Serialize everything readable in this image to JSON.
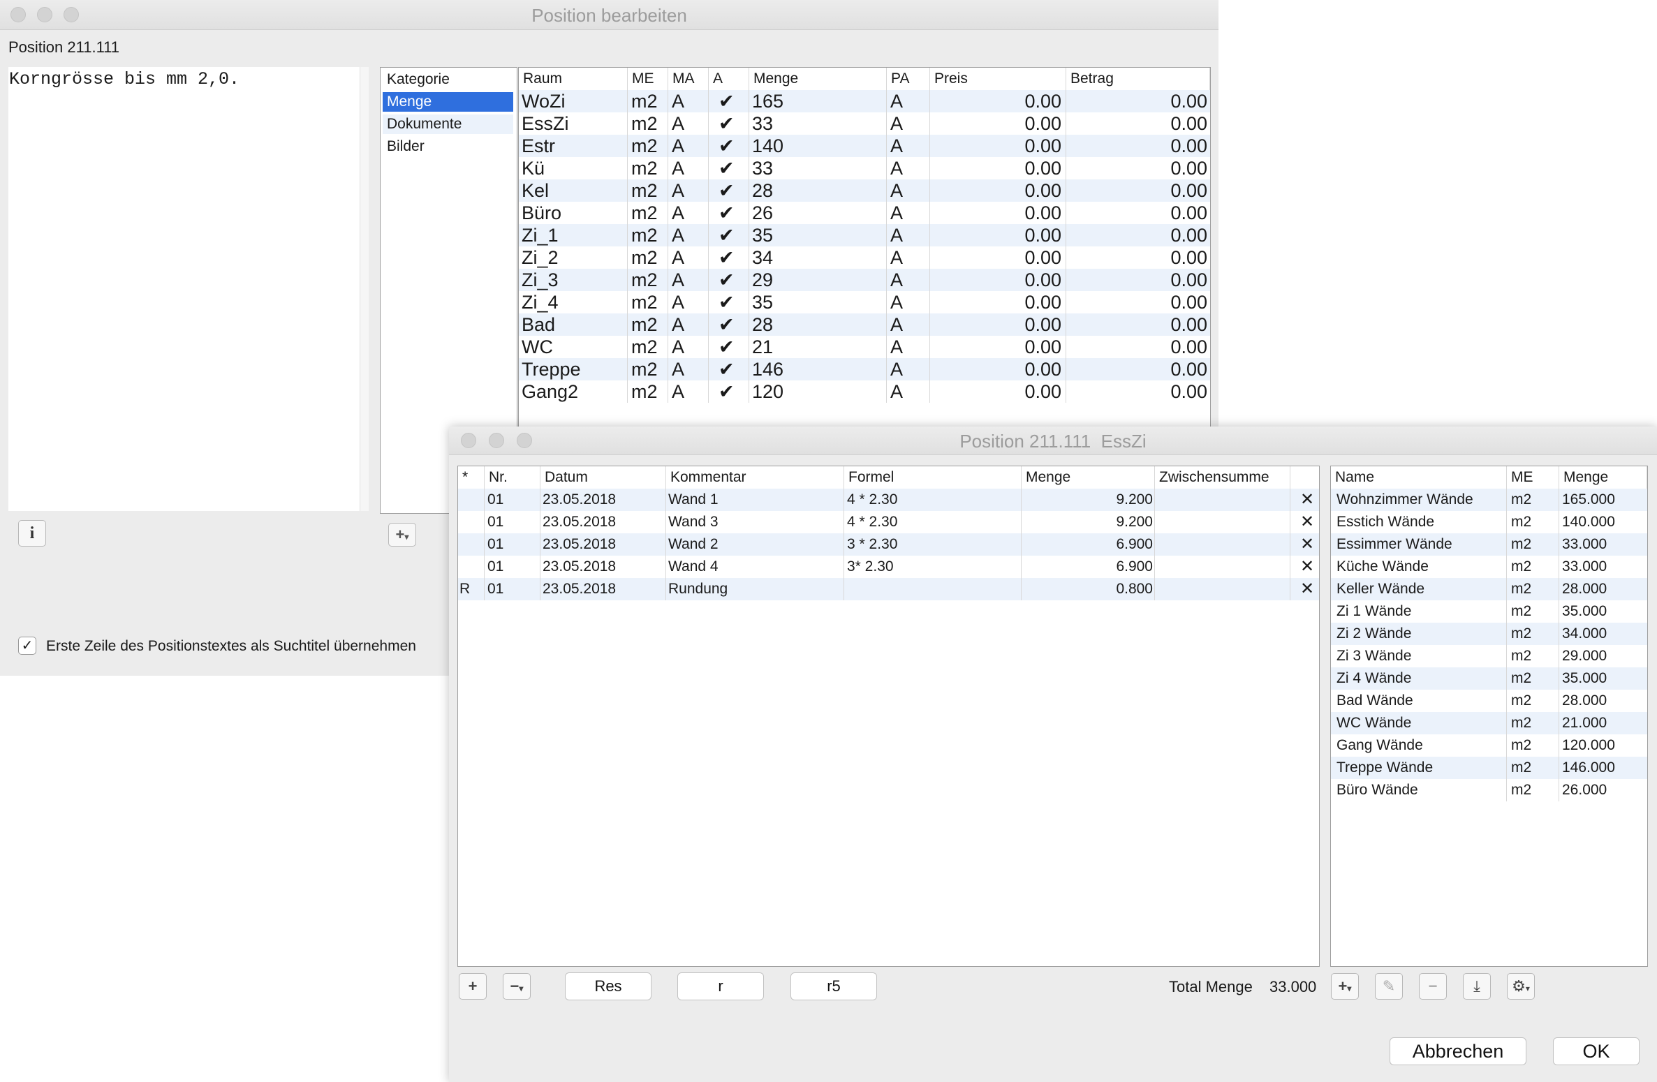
{
  "main_window": {
    "title": "Position bearbeiten",
    "position_label": "Position 211.111",
    "text": "Korngrösse bis mm 2,0.",
    "categories_header": "Kategorie",
    "categories": [
      "Menge",
      "Dokumente",
      "Bilder"
    ],
    "selected_category": "Menge",
    "info_icon": "info-icon",
    "checkbox_label": "Erste Zeile des Positionstextes als Suchtitel übernehmen",
    "checkbox_checked": true,
    "table": {
      "columns": [
        "Raum",
        "ME",
        "MA",
        "A",
        "Menge",
        "PA",
        "Preis",
        "Betrag"
      ],
      "rows": [
        {
          "raum": "WoZi",
          "me": "m2",
          "ma": "A",
          "a": "✔",
          "menge": "165",
          "pa": "A",
          "preis": "0.00",
          "betrag": "0.00"
        },
        {
          "raum": "EssZi",
          "me": "m2",
          "ma": "A",
          "a": "✔",
          "menge": "33",
          "pa": "A",
          "preis": "0.00",
          "betrag": "0.00"
        },
        {
          "raum": "Estr",
          "me": "m2",
          "ma": "A",
          "a": "✔",
          "menge": "140",
          "pa": "A",
          "preis": "0.00",
          "betrag": "0.00"
        },
        {
          "raum": "Kü",
          "me": "m2",
          "ma": "A",
          "a": "✔",
          "menge": "33",
          "pa": "A",
          "preis": "0.00",
          "betrag": "0.00"
        },
        {
          "raum": "Kel",
          "me": "m2",
          "ma": "A",
          "a": "✔",
          "menge": "28",
          "pa": "A",
          "preis": "0.00",
          "betrag": "0.00"
        },
        {
          "raum": "Büro",
          "me": "m2",
          "ma": "A",
          "a": "✔",
          "menge": "26",
          "pa": "A",
          "preis": "0.00",
          "betrag": "0.00"
        },
        {
          "raum": "Zi_1",
          "me": "m2",
          "ma": "A",
          "a": "✔",
          "menge": "35",
          "pa": "A",
          "preis": "0.00",
          "betrag": "0.00"
        },
        {
          "raum": "Zi_2",
          "me": "m2",
          "ma": "A",
          "a": "✔",
          "menge": "34",
          "pa": "A",
          "preis": "0.00",
          "betrag": "0.00"
        },
        {
          "raum": "Zi_3",
          "me": "m2",
          "ma": "A",
          "a": "✔",
          "menge": "29",
          "pa": "A",
          "preis": "0.00",
          "betrag": "0.00"
        },
        {
          "raum": "Zi_4",
          "me": "m2",
          "ma": "A",
          "a": "✔",
          "menge": "35",
          "pa": "A",
          "preis": "0.00",
          "betrag": "0.00"
        },
        {
          "raum": "Bad",
          "me": "m2",
          "ma": "A",
          "a": "✔",
          "menge": "28",
          "pa": "A",
          "preis": "0.00",
          "betrag": "0.00"
        },
        {
          "raum": "WC",
          "me": "m2",
          "ma": "A",
          "a": "✔",
          "menge": "21",
          "pa": "A",
          "preis": "0.00",
          "betrag": "0.00"
        },
        {
          "raum": "Treppe",
          "me": "m2",
          "ma": "A",
          "a": "✔",
          "menge": "146",
          "pa": "A",
          "preis": "0.00",
          "betrag": "0.00"
        },
        {
          "raum": "Gang2",
          "me": "m2",
          "ma": "A",
          "a": "✔",
          "menge": "120",
          "pa": "A",
          "preis": "0.00",
          "betrag": "0.00"
        }
      ]
    }
  },
  "sub_window": {
    "title": "Position 211.111  EssZi",
    "table": {
      "columns": [
        "*",
        "Nr.",
        "Datum",
        "Kommentar",
        "Formel",
        "Menge",
        "Zwischensumme"
      ],
      "rows": [
        {
          "star": "",
          "nr": "01",
          "datum": "23.05.2018",
          "kommentar": "Wand 1",
          "formel": "4 * 2.30",
          "menge": "9.200",
          "zwischensumme": "",
          "delete": "✕"
        },
        {
          "star": "",
          "nr": "01",
          "datum": "23.05.2018",
          "kommentar": "Wand 3",
          "formel": "4 * 2.30",
          "menge": "9.200",
          "zwischensumme": "",
          "delete": "✕"
        },
        {
          "star": "",
          "nr": "01",
          "datum": "23.05.2018",
          "kommentar": "Wand 2",
          "formel": "3 * 2.30",
          "menge": "6.900",
          "zwischensumme": "",
          "delete": "✕"
        },
        {
          "star": "",
          "nr": "01",
          "datum": "23.05.2018",
          "kommentar": "Wand 4",
          "formel": "3*  2.30",
          "menge": "6.900",
          "zwischensumme": "",
          "delete": "✕"
        },
        {
          "star": "R",
          "nr": "01",
          "datum": "23.05.2018",
          "kommentar": "Rundung",
          "formel": "",
          "menge": "0.800",
          "zwischensumme": "",
          "delete": "✕"
        }
      ]
    },
    "right_table": {
      "columns": [
        "Name",
        "ME",
        "Menge"
      ],
      "rows": [
        {
          "name": "Wohnzimmer Wände",
          "me": "m2",
          "menge": "165.000"
        },
        {
          "name": "Esstich Wände",
          "me": "m2",
          "menge": "140.000"
        },
        {
          "name": "Essimmer Wände",
          "me": "m2",
          "menge": "33.000"
        },
        {
          "name": "Küche Wände",
          "me": "m2",
          "menge": "33.000"
        },
        {
          "name": "Keller Wände",
          "me": "m2",
          "menge": "28.000"
        },
        {
          "name": "Zi 1 Wände",
          "me": "m2",
          "menge": "35.000"
        },
        {
          "name": "Zi 2 Wände",
          "me": "m2",
          "menge": "34.000"
        },
        {
          "name": "Zi 3 Wände",
          "me": "m2",
          "menge": "29.000"
        },
        {
          "name": "Zi 4 Wände",
          "me": "m2",
          "menge": "35.000"
        },
        {
          "name": "Bad Wände",
          "me": "m2",
          "menge": "28.000"
        },
        {
          "name": "WC Wände",
          "me": "m2",
          "menge": "21.000"
        },
        {
          "name": "Gang Wände",
          "me": "m2",
          "menge": "120.000"
        },
        {
          "name": "Treppe Wände",
          "me": "m2",
          "menge": "146.000"
        },
        {
          "name": "Büro Wände",
          "me": "m2",
          "menge": "26.000"
        }
      ]
    },
    "buttons": {
      "res": "Res",
      "r": "r",
      "r5": "r5"
    },
    "total_label": "Total Menge",
    "total_value": "33.000",
    "cancel_label": "Abbrechen",
    "ok_label": "OK"
  },
  "colors": {
    "selection": "#2f6fde",
    "row_alt": "#ebf2fb",
    "window_bg": "#ececec"
  }
}
